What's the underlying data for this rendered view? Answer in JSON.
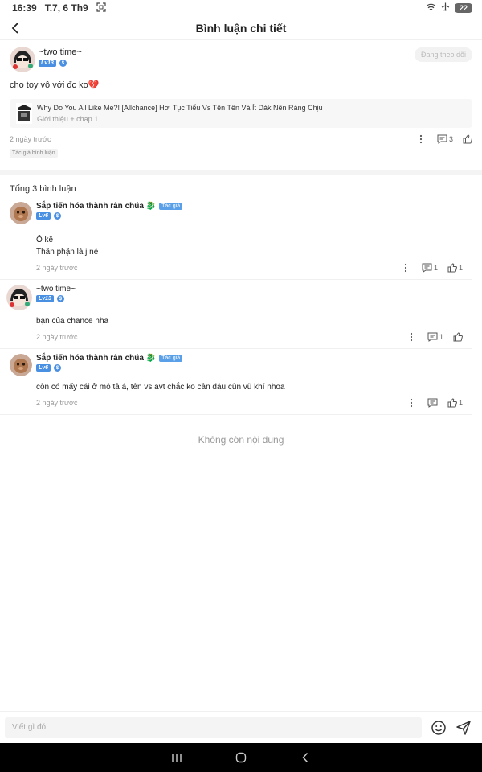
{
  "status": {
    "time": "16:39",
    "date": "T.7, 6 Th9",
    "battery": "22"
  },
  "header": {
    "title": "Bình luận chi tiết"
  },
  "main_comment": {
    "username": "~two time~",
    "level": "Lv13",
    "follow_label": "Đang theo dõi",
    "text": "cho toy vô với đc ko💔",
    "work": {
      "title": "Why Do You All Like Me?! [Allchance] Hơi Tục Tiểu Vs Tên Tên Và Ít Dảk Nên Ráng Chịu",
      "subtitle": "Giới thiệu + chap 1"
    },
    "time": "2 ngày trước",
    "reply_count": "3",
    "author_tag": "Tác giả bình luận"
  },
  "total": "Tổng 3 bình luận",
  "replies": [
    {
      "username": "Sắp tiến hóa thành rân chúa 🐉",
      "author_label": "Tác giả",
      "level": "Lv6",
      "lines": [
        "Ô kê",
        "Thân phận là j nè"
      ],
      "time": "2 ngày trước",
      "reply_count": "1",
      "like_count": "1"
    },
    {
      "username": "~two time~",
      "level": "Lv13",
      "lines": [
        "bạn của chance nha"
      ],
      "time": "2 ngày trước",
      "reply_count": "1",
      "like_count": ""
    },
    {
      "username": "Sắp tiến hóa thành rân chúa 🐉",
      "author_label": "Tác giả",
      "level": "Lv6",
      "lines": [
        "còn có mấy cái ở mô tả á, tên vs avt chắc ko cần đâu cùn vũ khí nhoa"
      ],
      "time": "2 ngày trước",
      "reply_count": "",
      "like_count": "1"
    }
  ],
  "no_more": "Không còn nội dung",
  "input": {
    "placeholder": "Viết gì đó"
  }
}
